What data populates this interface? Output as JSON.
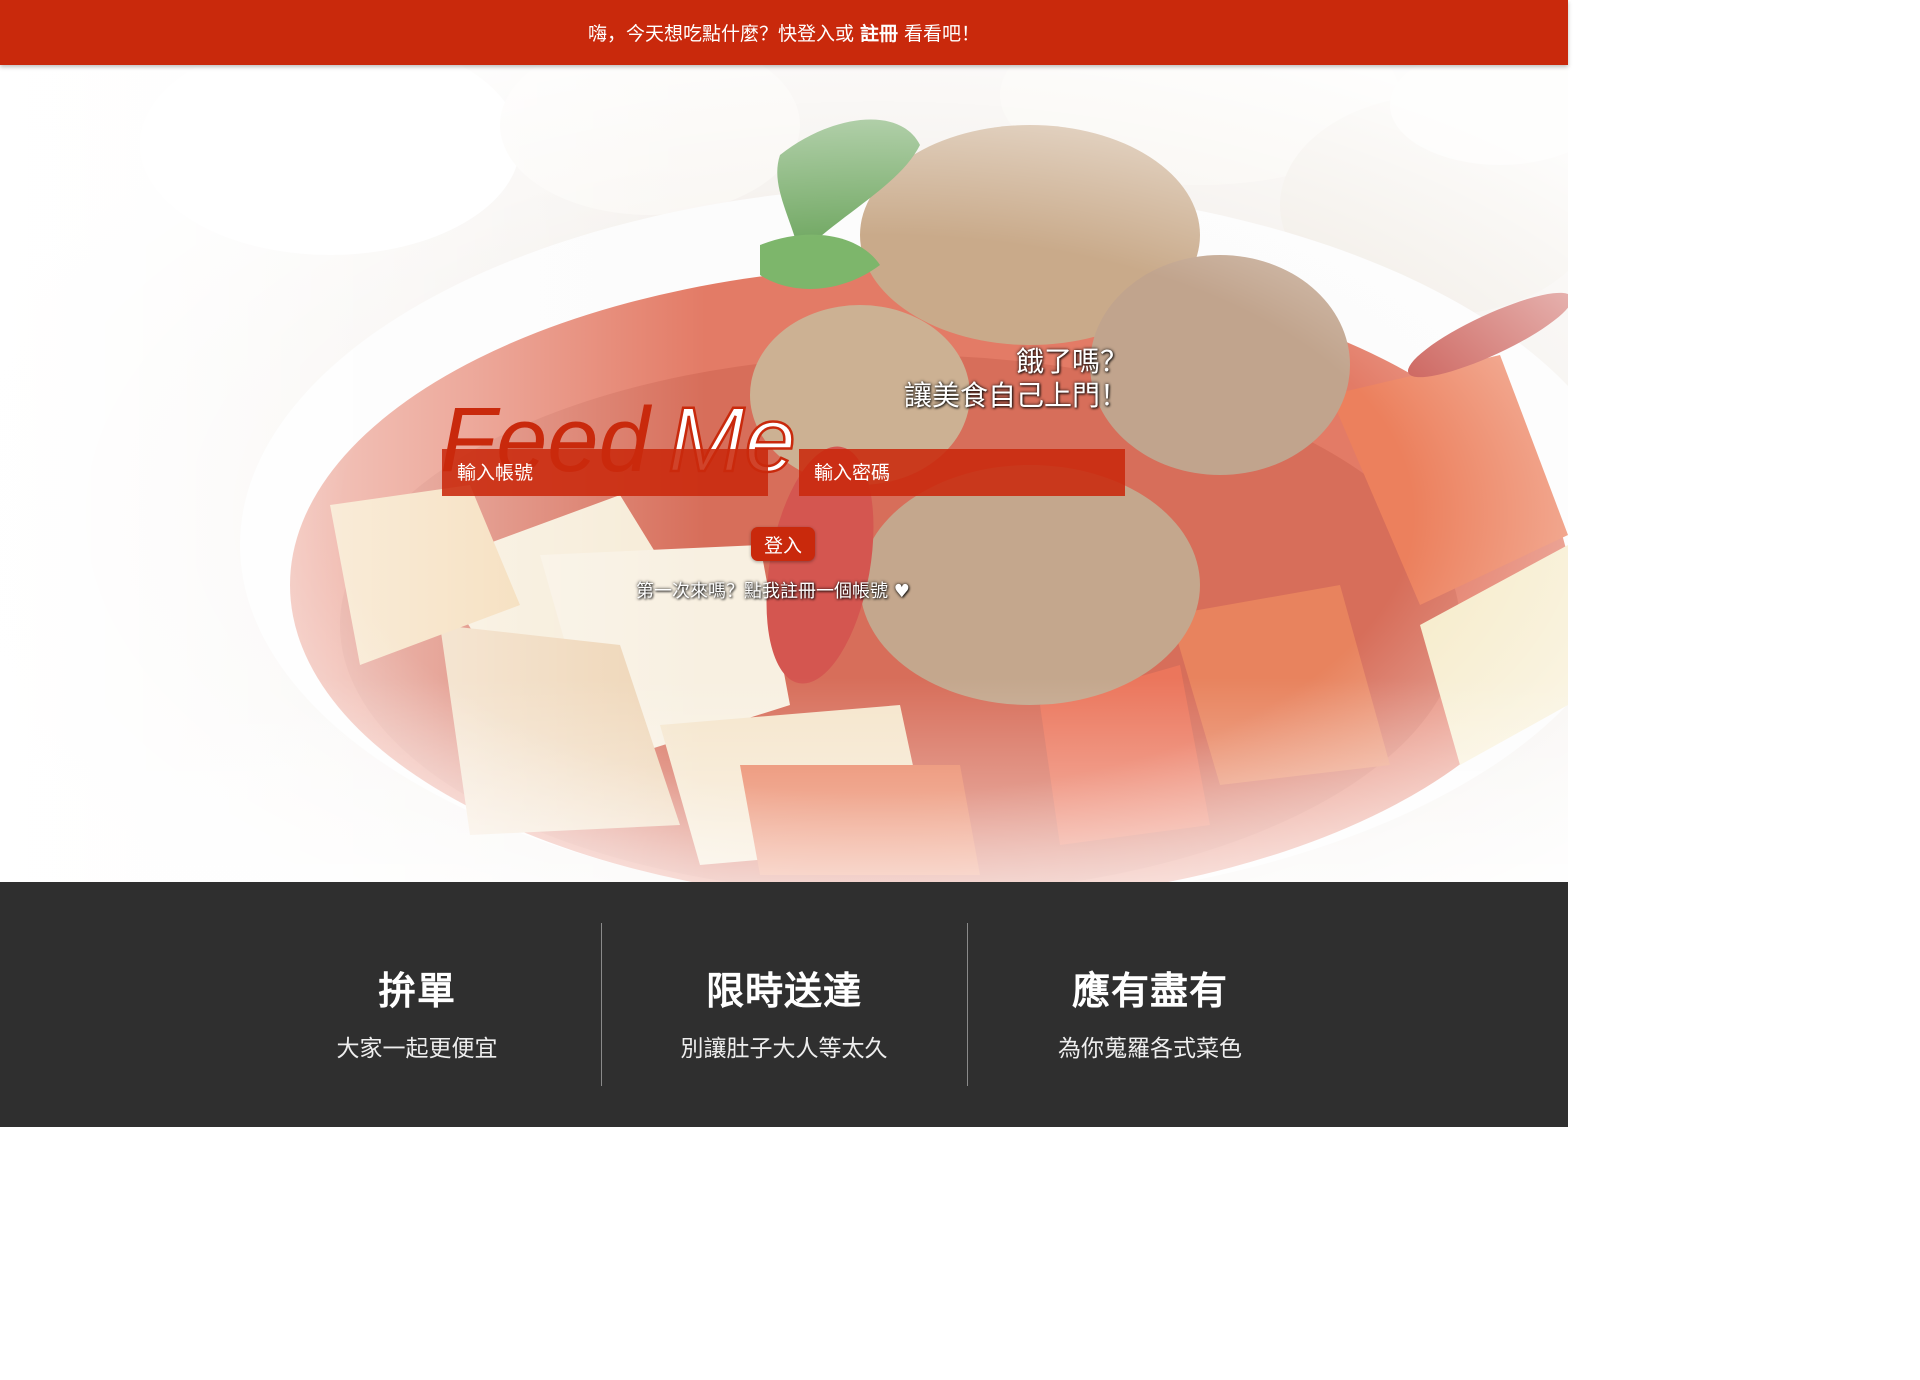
{
  "topbar": {
    "prefix": "嗨，今天想吃點什麼？快登入或",
    "register_link": "註冊",
    "suffix": "看看吧！"
  },
  "hero": {
    "logo_part1": "Feed",
    "logo_part2": "Me",
    "tagline_line1": "餓了嗎？",
    "tagline_line2": "讓美食自己上門！"
  },
  "login": {
    "account_placeholder": "輸入帳號",
    "password_placeholder": "輸入密碼",
    "submit_label": "登入",
    "signup_prompt": "第一次來嗎？點我註冊一個帳號",
    "heart_icon": "♥"
  },
  "features": [
    {
      "title": "拚單",
      "desc": "大家一起更便宜"
    },
    {
      "title": "限時送達",
      "desc": "別讓肚子大人等太久"
    },
    {
      "title": "應有盡有",
      "desc": "為你蒐羅各式菜色"
    }
  ],
  "colors": {
    "brand_red": "#c9290c",
    "footer_bg": "#2f2f2f"
  }
}
